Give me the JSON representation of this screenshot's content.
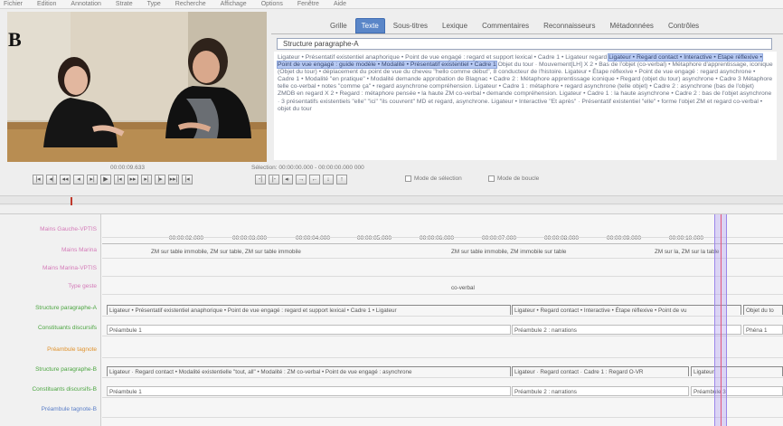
{
  "menu": [
    "Fichier",
    "Edition",
    "Annotation",
    "Strate",
    "Type",
    "Recherche",
    "Affichage",
    "Options",
    "Fenêtre",
    "Aide"
  ],
  "panel_label": "B",
  "tabs": [
    {
      "label": "Grille",
      "active": false
    },
    {
      "label": "Texte",
      "active": true
    },
    {
      "label": "Sous-titres",
      "active": false
    },
    {
      "label": "Lexique",
      "active": false
    },
    {
      "label": "Commentaires",
      "active": false
    },
    {
      "label": "Reconnaisseurs",
      "active": false
    },
    {
      "label": "Métadonnées",
      "active": false
    },
    {
      "label": "Contrôles",
      "active": false
    }
  ],
  "tier_selector": "Structure paragraphe-A",
  "annotation_text": {
    "pre": "Ligateur • Présentatif existentiel anaphorique • Point de vue engagé : regard et support lexical • Cadre 1 • Ligateur regard",
    "highlight": "Ligateur • Regard contact • Interactive • Étape réflexive • Point de vue engagé : guide modèle • Modalité • Présentatif existentiel • Cadre 1",
    "post": "Objet du tour · Mouvement[LH] X 2 • Bas de l'objet (co-verbal) • Métaphore d'apprentissage, iconique (Objet du tour) • déplacement du point de vue du cheveu \"hello comme début\", 8 conducteur de l'histoire. Ligateur • Étape réflexive • Point de vue engagé : regard asynchrone • Cadre 1 • Modalité \"en pratique\" • Modalité demande approbation de Blagnac • Cadre 2 : Métaphore apprentissage iconique • Regard (objet du tour) asynchrone • Cadre 3 Métaphore telle co-verbal • notes \"comme ça\" • regard asynchrone compréhension. Ligateur • Cadre 1 : métaphore • regard asynchrone (telle objet) • Cadre 2 : asynchrone (bas de l'objet) ZMDB en regard X 2 • Regard : métaphore pensée • la haute ZM co-verbal • demande compréhension. Ligateur • Cadre 1 : la haute asynchrone • Cadre 2 : bas de l'objet asynchrone · 3 présentatifs existentiels \"elle\" \"ici\" \"ils couvrent\" MD et regard, asynchrone. Ligateur • Interactive \"Et après\" · Présentatif existentiel \"elle\" • forme l'objet ZM et regard co-verbal • objet du tour"
  },
  "player": {
    "current_time": "00:00:09.633",
    "selection": "Sélection: 00:00:00.000 - 00:00:00.000  000",
    "buttons": [
      "|◂",
      "◂|",
      "◂◂",
      "◂",
      "▸|",
      "▶",
      "|◂",
      "▸▸",
      "▸|",
      "|▸",
      "▸▸|",
      "|◂"
    ],
    "buttons2": [
      "-|",
      "|-",
      "◂·",
      "→",
      "←",
      "↓",
      "↑"
    ],
    "mode_selection": "Mode de sélection",
    "mode_loop": "Mode de boucle"
  },
  "ruler_ticks": [
    "00:00:02.000",
    "00:00:03.000",
    "00:00:04.000",
    "00:00:05.000",
    "00:00:06.000",
    "00:00:07.000",
    "00:00:08.000",
    "00:00:09.000",
    "00:00:10.000"
  ],
  "tiers": [
    {
      "label": "Mains Gauche-VPTIS",
      "color": "pink"
    },
    {
      "label": "Mains Marina",
      "color": "pink"
    },
    {
      "label": "Mains Marina-VPTIS",
      "color": "pink"
    },
    {
      "label": "Type geste",
      "color": "pink"
    },
    {
      "label": "Structure paragraphe-A",
      "color": "green"
    },
    {
      "label": "Constituants discursifs",
      "color": "green"
    },
    {
      "label": "Préambule tagnote",
      "color": "orange"
    },
    {
      "label": "Structure paragraphe-B",
      "color": "green"
    },
    {
      "label": "Constituants discursifs-B",
      "color": "green"
    },
    {
      "label": "Préambule tagnote-B",
      "color": "blue"
    }
  ],
  "annotations": {
    "marina": [
      "ZM sur table immobile, ZM sur table, ZM sur table immobile",
      "ZM sur table immobile, ZM immobile sur table",
      "ZM sur la, ZM sur la table"
    ],
    "type": "co-verbal",
    "structA": [
      "Ligateur • Présentatif existentiel anaphorique • Point de vue engagé : regard et support lexical • Cadre 1 • Ligateur",
      "Ligateur • Regard contact • Interactive • Étape réflexive • Point de vu",
      "Objet du to"
    ],
    "constA": [
      "Préambule 1",
      "Préambule 2 : narrations",
      "Phéna 1"
    ],
    "structB": [
      "Ligateur · Regard contact • Modalité existentielle \"tout, all\" • Modalité : ZM co-verbal • Point de vue engagé : asynchrone",
      "Ligateur · Regard contact · Cadre 1 : Regard O-VR",
      "Ligateur"
    ],
    "constB": [
      "Préambule 1",
      "Préambule 2 : narrations",
      "Préambule 3"
    ]
  },
  "colors": {
    "tab_active": "#5a86c8",
    "highlight": "#b7c9f2",
    "cursor": "#a896f0",
    "green_tier": "#4ba540",
    "pink_tier": "#d47ab8"
  }
}
